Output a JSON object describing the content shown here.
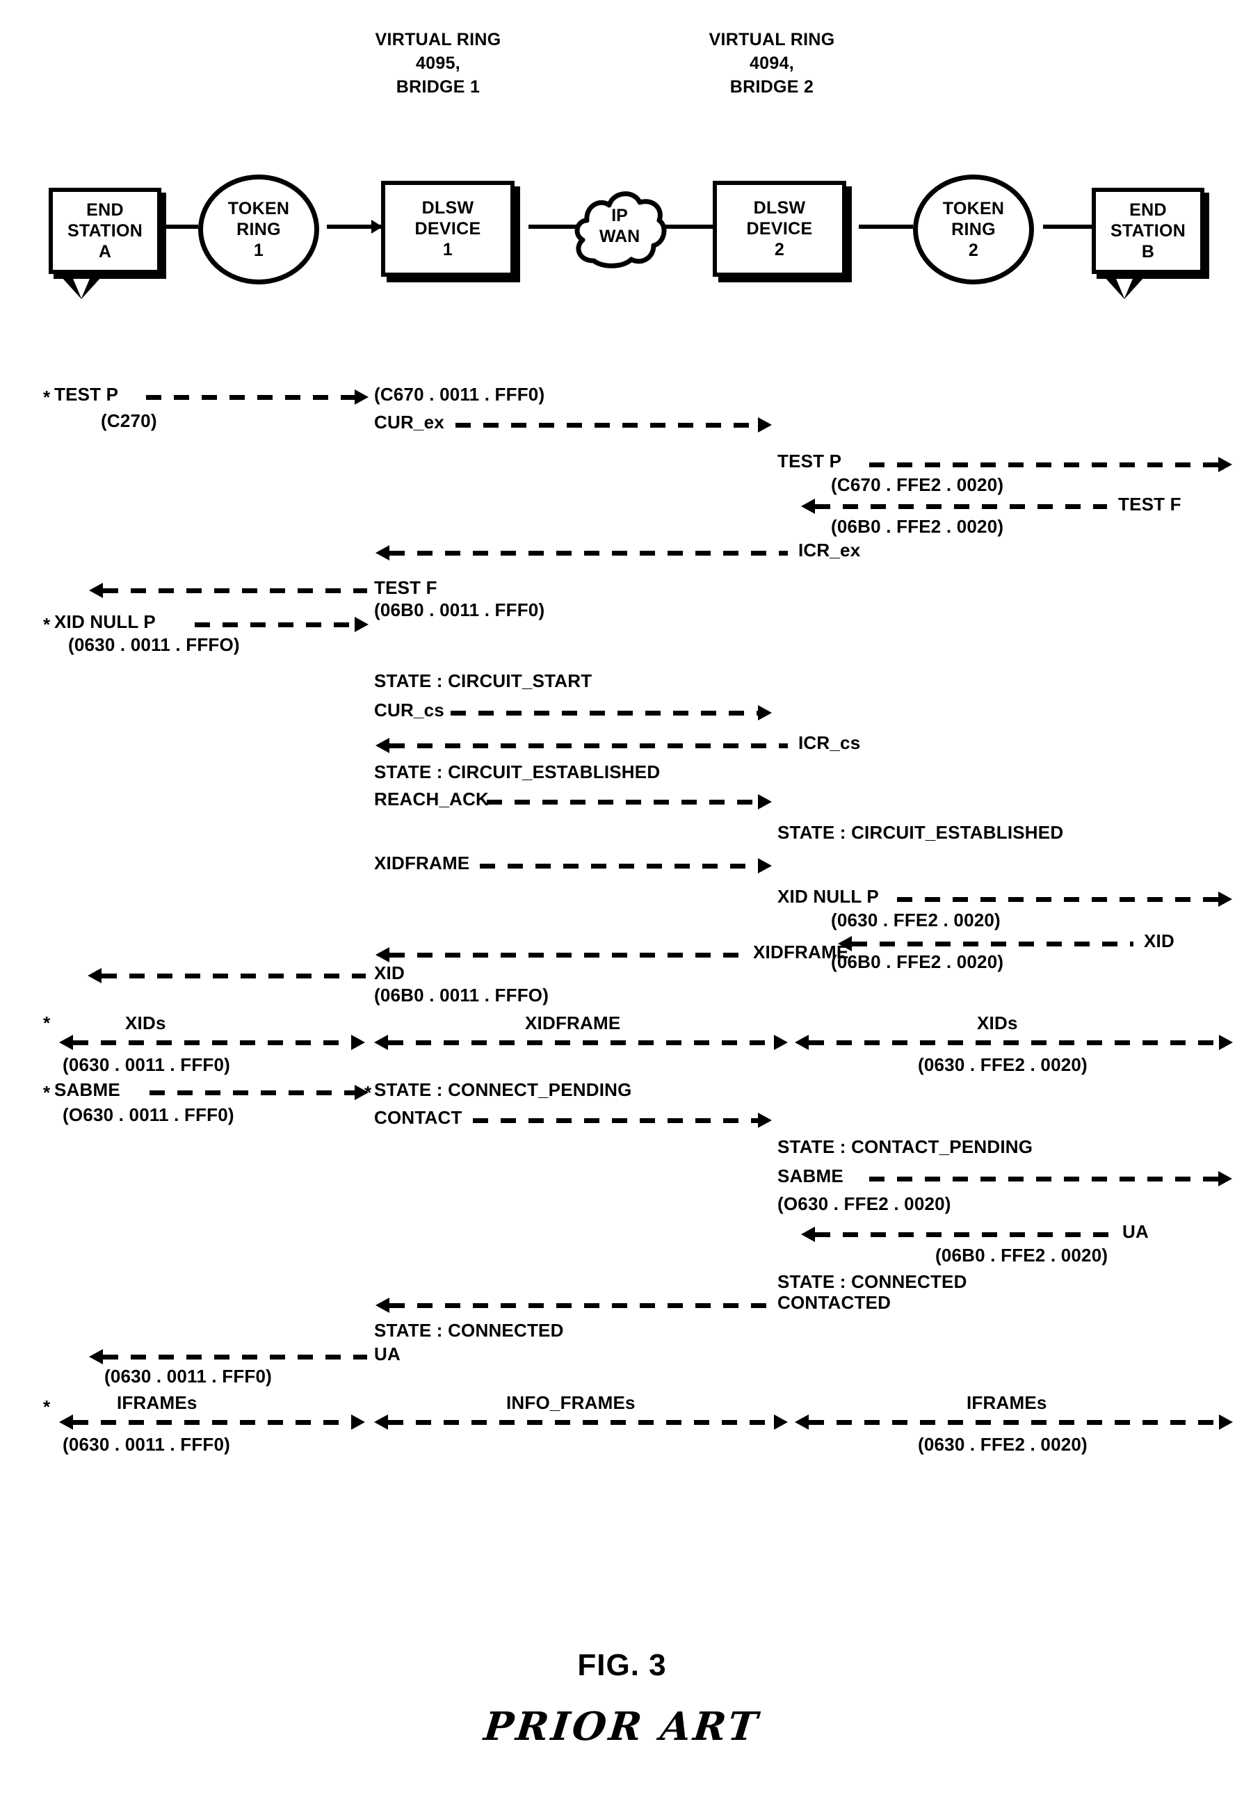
{
  "figure": {
    "caption": "FIG. 3",
    "annotation": "PRIOR ART"
  },
  "topology": {
    "ring_captions": [
      {
        "text": "VIRTUAL RING\n4095,\nBRIDGE 1"
      },
      {
        "text": "VIRTUAL RING\n4094,\nBRIDGE 2"
      }
    ],
    "nodes": [
      {
        "id": "end-station-a",
        "shape": "station",
        "lines": [
          "END",
          "STATION",
          "A"
        ]
      },
      {
        "id": "token-ring-1",
        "shape": "ellipse",
        "lines": [
          "TOKEN",
          "RING",
          "1"
        ]
      },
      {
        "id": "dlsw-device-1",
        "shape": "box",
        "lines": [
          "DLSW",
          "DEVICE",
          "1"
        ]
      },
      {
        "id": "ip-wan",
        "shape": "cloud",
        "lines": [
          "IP",
          "WAN"
        ]
      },
      {
        "id": "dlsw-device-2",
        "shape": "box",
        "lines": [
          "DLSW",
          "DEVICE",
          "2"
        ]
      },
      {
        "id": "token-ring-2",
        "shape": "ellipse",
        "lines": [
          "TOKEN",
          "RING",
          "2"
        ]
      },
      {
        "id": "end-station-b",
        "shape": "station",
        "lines": [
          "END",
          "STATION",
          "B"
        ]
      }
    ]
  },
  "sequence": {
    "messages": [
      {
        "id": "m01",
        "label": "TEST P",
        "addr": "(C270)",
        "star": true
      },
      {
        "id": "m02",
        "label": "",
        "addr": "(C670 . 0011 . FFF0)"
      },
      {
        "id": "m03",
        "label": "CUR_ex",
        "addr": ""
      },
      {
        "id": "m04",
        "label": "TEST P",
        "addr": "(C670 . FFE2 . 0020)"
      },
      {
        "id": "m05",
        "label": "TEST F",
        "addr": "(06B0 . FFE2 . 0020)"
      },
      {
        "id": "m06",
        "label": "ICR_ex",
        "addr": ""
      },
      {
        "id": "m07",
        "label": "TEST F",
        "addr": "(06B0 . 0011 . FFF0)"
      },
      {
        "id": "m08",
        "label": "XID NULL P",
        "addr": "(0630 . 0011 . FFFO)",
        "star": true
      },
      {
        "id": "m09",
        "label": "STATE : CIRCUIT_START",
        "addr": ""
      },
      {
        "id": "m10",
        "label": "CUR_cs",
        "addr": ""
      },
      {
        "id": "m11",
        "label": "ICR_cs",
        "addr": ""
      },
      {
        "id": "m12",
        "label": "STATE : CIRCUIT_ESTABLISHED",
        "addr": ""
      },
      {
        "id": "m13",
        "label": "REACH_ACK",
        "addr": ""
      },
      {
        "id": "m14",
        "label": "STATE : CIRCUIT_ESTABLISHED",
        "addr": ""
      },
      {
        "id": "m15",
        "label": "XIDFRAME",
        "addr": ""
      },
      {
        "id": "m16",
        "label": "XID NULL P",
        "addr": "(0630 . FFE2 . 0020)"
      },
      {
        "id": "m17",
        "label": "XID",
        "addr": "(06B0 . FFE2 . 0020)"
      },
      {
        "id": "m18",
        "label": "XIDFRAME",
        "addr": ""
      },
      {
        "id": "m19",
        "label": "XID",
        "addr": "(06B0 . 0011 . FFFO)"
      },
      {
        "id": "m20",
        "label": "XIDs",
        "addr": "(0630 . 0011 . FFF0)",
        "star": true
      },
      {
        "id": "m21",
        "label": "XIDFRAME",
        "addr": ""
      },
      {
        "id": "m22",
        "label": "XIDs",
        "addr": "(0630 . FFE2 . 0020)"
      },
      {
        "id": "m23",
        "label": "SABME",
        "addr": "(O630 . 0011 . FFF0)",
        "star": true
      },
      {
        "id": "m24",
        "label": "STATE : CONNECT_PENDING",
        "addr": ""
      },
      {
        "id": "m25",
        "label": "CONTACT",
        "addr": ""
      },
      {
        "id": "m26",
        "label": "STATE : CONTACT_PENDING",
        "addr": ""
      },
      {
        "id": "m27",
        "label": "SABME",
        "addr": "(O630 . FFE2 . 0020)"
      },
      {
        "id": "m28",
        "label": "UA",
        "addr": "(06B0 . FFE2 . 0020)"
      },
      {
        "id": "m29",
        "label": "STATE : CONNECTED",
        "addr": ""
      },
      {
        "id": "m30",
        "label": "CONTACTED",
        "addr": ""
      },
      {
        "id": "m31",
        "label": "STATE : CONNECTED",
        "addr": ""
      },
      {
        "id": "m32",
        "label": "UA",
        "addr": "(0630 . 0011 . FFF0)"
      },
      {
        "id": "m33",
        "label": "IFRAMEs",
        "addr": "(0630 . 0011 . FFF0)",
        "star": true
      },
      {
        "id": "m34",
        "label": "INFO_FRAMEs",
        "addr": ""
      },
      {
        "id": "m35",
        "label": "IFRAMEs",
        "addr": "(0630 . FFE2 . 0020)"
      }
    ]
  }
}
